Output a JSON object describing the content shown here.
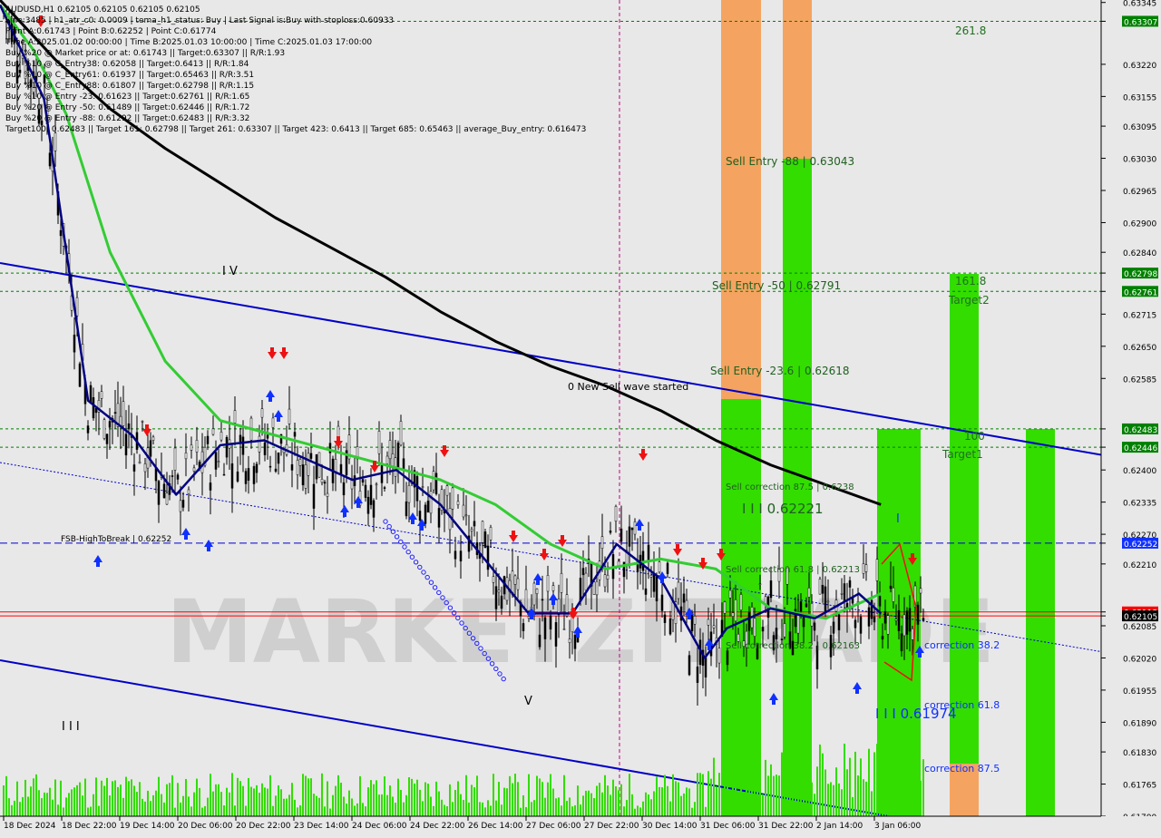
{
  "chart_data": {
    "type": "line",
    "symbol": "AUDUSD,H1",
    "colors": {
      "background": "#e8e8e8",
      "blue_line": "#0000c8",
      "green_zone": "#33dd00",
      "orange_zone": "#f4a460",
      "black_ma": "#000000",
      "green_ma": "#33cc33",
      "navy_ma": "#000080",
      "red_level": "#ff0000",
      "level_dotted": "#008000",
      "price_tag_bg": "#008000",
      "current_price_bg": "#000000"
    },
    "header_lines": [
      "AUDUSD,H1  0.62105 0.62105 0.62105 0.62105",
      "Line:3485 | h1_atr_c0: 0.0009 | tema_h1_status: Buy | Last Signal is:Buy with stoploss:0.60933",
      "Point A:0.61743 | Point B:0.62252 | Point C:0.61774",
      "Time A:2025.01.02 00:00:00 | Time B:2025.01.03 10:00:00 | Time C:2025.01.03 17:00:00",
      "Buy %20 @ Market price or at: 0.61743 || Target:0.63307 || R/R:1.93",
      "Buy %10 @ C_Entry38: 0.62058 || Target:0.6413 || R/R:1.84",
      "Buy %10 @ C_Entry61: 0.61937 || Target:0.65463 || R/R:3.51",
      "Buy %10 @ C_Entry88: 0.61807 || Target:0.62798 || R/R:1.15",
      "Buy %10 @ Entry -23: 0.61623 || Target:0.62761 || R/R:1.65",
      "Buy %20 @ Entry -50: 0.61489 || Target:0.62446 || R/R:1.72",
      "Buy %20 @ Entry -88: 0.61292 || Target:0.62483 || R/R:3.32",
      "Target100: 0.62483 || Target 161: 0.62798 || Target 261: 0.63307 || Target 423: 0.6413 || Target 685: 0.65463 || average_Buy_entry: 0.616473"
    ],
    "y_ticks": [
      "0.63345",
      "0.63307",
      "0.63220",
      "0.63155",
      "0.63095",
      "0.63030",
      "0.62965",
      "0.62900",
      "0.62840",
      "0.62798",
      "0.62761",
      "0.62715",
      "0.62650",
      "0.62585",
      "0.62483",
      "0.62446",
      "0.62400",
      "0.62335",
      "0.62270",
      "0.62252",
      "0.62210",
      "0.62113",
      "0.62105",
      "0.62085",
      "0.62020",
      "0.61955",
      "0.61890",
      "0.61830",
      "0.61765",
      "0.61700"
    ],
    "x_ticks": [
      "18 Dec 2024",
      "18 Dec 22:00",
      "19 Dec 14:00",
      "20 Dec 06:00",
      "20 Dec 22:00",
      "23 Dec 14:00",
      "24 Dec 06:00",
      "24 Dec 22:00",
      "26 Dec 14:00",
      "27 Dec 06:00",
      "27 Dec 22:00",
      "30 Dec 14:00",
      "31 Dec 06:00",
      "31 Dec 22:00",
      "2 Jan 14:00",
      "3 Jan 06:00"
    ],
    "ylim": [
      0.617,
      0.6335
    ],
    "price_tags": [
      {
        "value": "0.63307",
        "style": "green"
      },
      {
        "value": "0.62798",
        "style": "green"
      },
      {
        "value": "0.62761",
        "style": "green"
      },
      {
        "value": "0.62483",
        "style": "green"
      },
      {
        "value": "0.62446",
        "style": "green"
      },
      {
        "value": "0.62252",
        "style": "blue"
      },
      {
        "value": "0.62113",
        "style": "red"
      },
      {
        "value": "0.62105",
        "style": "black"
      }
    ],
    "level_labels": {
      "fib_261": "261.8",
      "fib_161": "161.8",
      "target2": "Target2",
      "fib_100": "100",
      "target1": "Target1",
      "sell_entry_88": "Sell Entry -88 | 0.63043",
      "sell_entry_50": "Sell Entry -50 | 0.62791",
      "sell_entry_23": "Sell Entry -23.6 | 0.62618",
      "new_sell_wave": "0 New Sell wave started",
      "sell_corr_875": "Sell correction 87.5 | 0.6238",
      "wave_iii_sell": "I I I  0.62221",
      "sell_corr_618": "Sell correction 61.8 | 0.62213",
      "sell_corr_382": "Sell correction 38.2 | 0.62163",
      "fsb": "FSB-HighToBreak | 0.62252",
      "corr_382": "correction 38.2",
      "corr_618": "correction 61.8",
      "corr_875": "correction 87.5",
      "wave_iii_buy": "I I I  0.61974",
      "wave_iv": "I V",
      "wave_iii_left": "I I I",
      "wave_v": "V",
      "wave_i": "I"
    },
    "watermark": "MARKETZITRADE",
    "series": [
      {
        "name": "",
        "kind": "ma_black",
        "x": [
          0,
          0.05,
          0.1,
          0.15,
          0.2,
          0.25,
          0.3,
          0.35,
          0.4,
          0.45,
          0.5,
          0.55,
          0.6,
          0.65,
          0.7,
          0.75,
          0.8
        ],
        "values": [
          0.6335,
          0.6323,
          0.6313,
          0.6305,
          0.6298,
          0.6291,
          0.6285,
          0.6279,
          0.6272,
          0.6266,
          0.6261,
          0.6257,
          0.6252,
          0.6246,
          0.6241,
          0.6237,
          0.6233
        ]
      },
      {
        "name": "",
        "kind": "ma_green",
        "x": [
          0,
          0.03,
          0.06,
          0.1,
          0.15,
          0.2,
          0.25,
          0.3,
          0.35,
          0.4,
          0.45,
          0.5,
          0.55,
          0.6,
          0.65,
          0.7,
          0.75,
          0.8
        ],
        "values": [
          0.6334,
          0.6325,
          0.6312,
          0.6284,
          0.6262,
          0.625,
          0.6247,
          0.6244,
          0.6241,
          0.6238,
          0.6233,
          0.6225,
          0.622,
          0.6222,
          0.622,
          0.6212,
          0.621,
          0.6215
        ]
      },
      {
        "name": "",
        "kind": "ma_navy",
        "x": [
          0,
          0.04,
          0.08,
          0.12,
          0.16,
          0.2,
          0.24,
          0.28,
          0.32,
          0.36,
          0.4,
          0.44,
          0.48,
          0.52,
          0.56,
          0.6,
          0.64,
          0.66,
          0.7,
          0.74,
          0.78,
          0.8
        ],
        "values": [
          0.6334,
          0.6315,
          0.6254,
          0.6247,
          0.6235,
          0.6245,
          0.6246,
          0.6242,
          0.6238,
          0.624,
          0.6233,
          0.6222,
          0.6211,
          0.6211,
          0.6225,
          0.6218,
          0.6202,
          0.6208,
          0.6212,
          0.621,
          0.6215,
          0.6211
        ]
      }
    ]
  }
}
